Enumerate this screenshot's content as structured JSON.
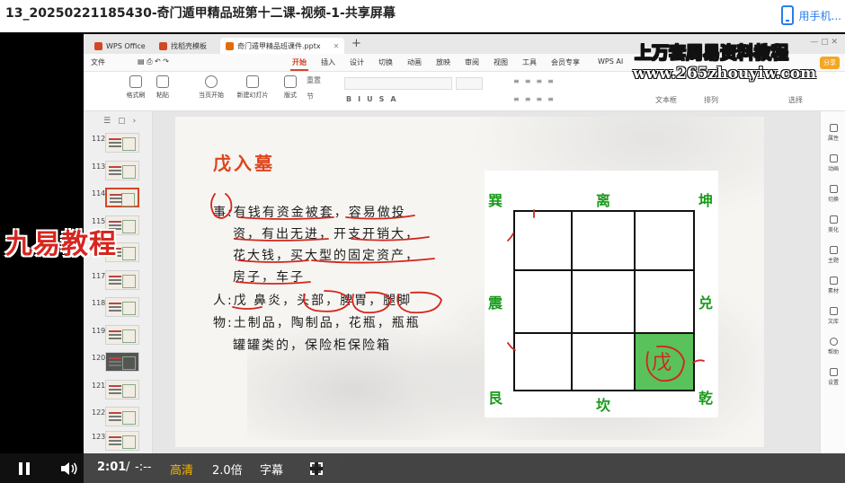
{
  "header": {
    "title": "13_20250221185430-奇门遁甲精品班第十二课-视频-1-共享屏幕",
    "phone_label": "用手机..."
  },
  "wps": {
    "tabs": [
      {
        "label": "WPS Office",
        "color": "#d24726"
      },
      {
        "label": "找稻壳模板",
        "color": "#d24726"
      },
      {
        "label": "奇门遁甲精品班课件.pptx",
        "color": "#e36c0a"
      }
    ],
    "menu": [
      "文件",
      "开始",
      "插入",
      "设计",
      "切换",
      "动画",
      "放映",
      "审阅",
      "视图",
      "工具",
      "会员专享",
      "WPS AI"
    ],
    "active_menu": "开始",
    "share_label": "分享",
    "ribbon": {
      "format_painter": "格式刷",
      "paste": "粘贴",
      "play_from_current": "当页开始",
      "new_slide": "新建幻灯片",
      "layout": "版式",
      "section": "节",
      "reset": "重置",
      "textbox": "文本框",
      "arrange": "排列",
      "select": "选择"
    }
  },
  "slides": {
    "numbers": [
      "112",
      "113",
      "114",
      "115",
      "116",
      "117",
      "118",
      "119",
      "120",
      "121",
      "122",
      "123"
    ],
    "selected": "114"
  },
  "right_panel": [
    "属性",
    "动画",
    "切换",
    "美化",
    "主题",
    "素材",
    "文库",
    "帮助",
    "设置"
  ],
  "slide": {
    "title": "戊入墓",
    "lines": [
      "事:有钱有资金被套，容易做投",
      "资，有出无进，开支开销大，",
      "花大钱，买大型的固定资产，",
      "房子，车子",
      "人:戊 鼻炎，头部，脾胃，腿脚",
      "物:土制品，陶制品，花瓶，瓶瓶",
      "罐罐类的，保险柜保险箱"
    ],
    "bagua": {
      "xun": "巽",
      "li": "离",
      "kun": "坤",
      "zhen": "震",
      "dui": "兑",
      "gen": "艮",
      "kan": "坎",
      "qian": "乾",
      "marked": "戊"
    }
  },
  "watermarks": {
    "top": "上万套周易资料教程",
    "url": "www.265zhouyiw.com",
    "left": "九易教程"
  },
  "player": {
    "time": "2:01",
    "separator": "/",
    "duration": "-:--",
    "quality": "高清",
    "speed": "2.0倍",
    "subtitles": "字幕"
  }
}
